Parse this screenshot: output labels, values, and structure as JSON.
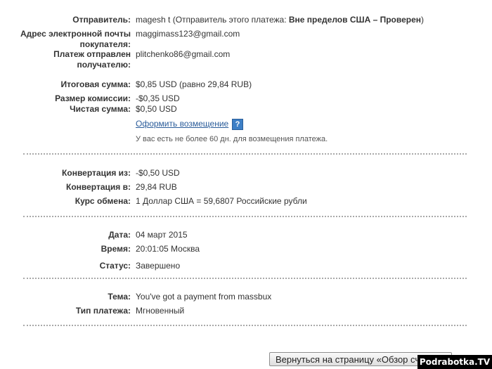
{
  "payment": {
    "sender_label": "Отправитель:",
    "sender_name": "magesh t",
    "sender_note_prefix": " (Отправитель этого платежа: ",
    "sender_status": "Вне пределов США – Проверен",
    "sender_note_suffix": ")",
    "buyer_email_label": "Адрес электронной почты покупателя:",
    "buyer_email": "maggimass123@gmail.com",
    "recipient_label": "Платеж отправлен получателю:",
    "recipient_email": "plitchenko86@gmail.com"
  },
  "amounts": {
    "total_label": "Итоговая сумма:",
    "total_value": "$0,85 USD (равно 29,84 RUB)",
    "fee_label": "Размер комиссии:",
    "fee_value": "-$0,35 USD",
    "net_label": "Чистая сумма:",
    "net_value": "$0,50 USD",
    "refund_link": "Оформить возмещение",
    "help_glyph": "?",
    "refund_note": "У вас есть не более 60 дн. для возмещения платежа."
  },
  "conversion": {
    "from_label": "Конвертация из:",
    "from_value": "-$0,50 USD",
    "to_label": "Конвертация в:",
    "to_value": "29,84 RUB",
    "rate_label": "Курс обмена:",
    "rate_value": "1 Доллар США = 59,6807 Российские рубли"
  },
  "details": {
    "date_label": "Дата:",
    "date_value": "04 март 2015",
    "time_label": "Время:",
    "time_value": "20:01:05 Москва",
    "status_label": "Статус:",
    "status_value": "Завершено"
  },
  "message": {
    "subject_label": "Тема:",
    "subject_value": "You've got a payment from massbux",
    "type_label": "Тип платежа:",
    "type_value": "Мгновенный"
  },
  "footer": {
    "back_button": "Вернуться на страницу «Обзор счета»",
    "watermark": "Podrabotka.TV"
  }
}
